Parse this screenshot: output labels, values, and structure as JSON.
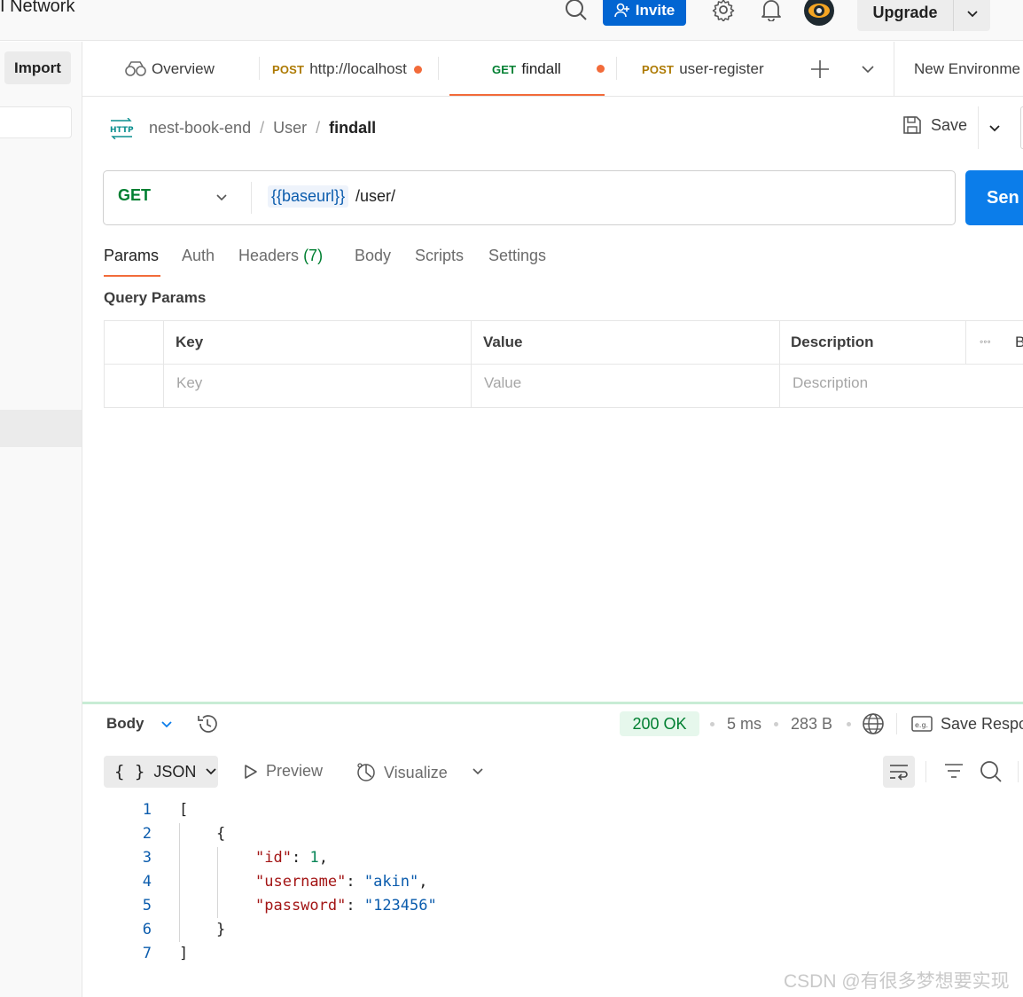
{
  "header": {
    "app_title": "I Network",
    "invite_label": "Invite",
    "upgrade_label": "Upgrade"
  },
  "sidebar": {
    "import_label": "Import"
  },
  "tabs": [
    {
      "method": "",
      "label": "Overview"
    },
    {
      "method": "POST",
      "label": "http://localhost"
    },
    {
      "method": "GET",
      "label": "findall"
    },
    {
      "method": "POST",
      "label": "user-register"
    }
  ],
  "environment_label": "New Environme",
  "breadcrumb": {
    "protocol_badge": "HTTP",
    "collection": "nest-book-end",
    "folder": "User",
    "request": "findall",
    "separator": "/"
  },
  "save_label": "Save",
  "request": {
    "method": "GET",
    "url_variable": "{{baseurl}}",
    "url_path": "/user/",
    "send_label": "Sen"
  },
  "request_tabs": {
    "params": "Params",
    "auth": "Auth",
    "headers": "Headers",
    "headers_count": "(7)",
    "body": "Body",
    "scripts": "Scripts",
    "settings": "Settings"
  },
  "query_params": {
    "title": "Query Params",
    "headers": {
      "key": "Key",
      "value": "Value",
      "description": "Description",
      "more": "◦◦◦",
      "bulk": "B"
    },
    "placeholders": {
      "key": "Key",
      "value": "Value",
      "description": "Description"
    }
  },
  "response": {
    "body_label": "Body",
    "status": "200 OK",
    "time": "5 ms",
    "size": "283 B",
    "save_response": "Save Respo",
    "format": "JSON",
    "preview": "Preview",
    "visualize": "Visualize",
    "code_lines": [
      "1",
      "2",
      "3",
      "4",
      "5",
      "6",
      "7"
    ],
    "json": {
      "open_array": "[",
      "open_obj": "{",
      "id_key": "\"id\"",
      "id_val": "1",
      "username_key": "\"username\"",
      "username_val": "\"akin\"",
      "password_key": "\"password\"",
      "password_val": "\"123456\"",
      "close_obj": "}",
      "close_array": "]"
    }
  },
  "watermark": "CSDN @有很多梦想要实现",
  "colors": {
    "accent_orange": "#f26b3a",
    "get_green": "#007f31",
    "post_amber": "#ad7a03",
    "send_blue": "#0b7dea",
    "invite_blue": "#0265d2"
  }
}
